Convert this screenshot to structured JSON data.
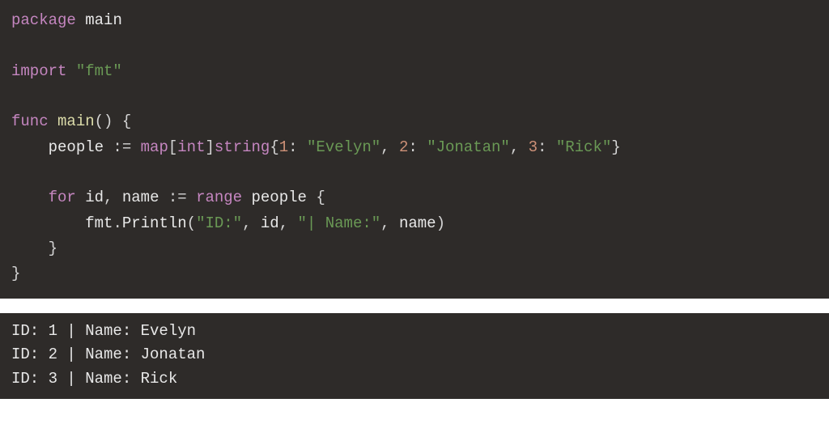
{
  "code": {
    "line1": {
      "kw_package": "package",
      "pkg_name": "main"
    },
    "line3": {
      "kw_import": "import",
      "import_path": "\"fmt\""
    },
    "line5": {
      "kw_func": "func",
      "fn_name": "main",
      "parens": "()",
      "brace_open": " {"
    },
    "line6": {
      "indent": "    ",
      "var_people": "people",
      "op_decl": " := ",
      "kw_map": "map",
      "bracket_open": "[",
      "type_int": "int",
      "bracket_close": "]",
      "type_string": "string",
      "brace_open": "{",
      "k1": "1",
      "colon1": ": ",
      "v1": "\"Evelyn\"",
      "comma1": ", ",
      "k2": "2",
      "colon2": ": ",
      "v2": "\"Jonatan\"",
      "comma2": ", ",
      "k3": "3",
      "colon3": ": ",
      "v3": "\"Rick\"",
      "brace_close": "}"
    },
    "line8": {
      "indent": "    ",
      "kw_for": "for",
      "var_id": " id",
      "comma": ", ",
      "var_name": "name",
      "op_decl": " := ",
      "kw_range": "range",
      "var_people": " people",
      "brace_open": " {"
    },
    "line9": {
      "indent": "        ",
      "pkg_fmt": "fmt",
      "dot": ".",
      "fn_println": "Println",
      "paren_open": "(",
      "arg1": "\"ID:\"",
      "c1": ", ",
      "arg2": "id",
      "c2": ", ",
      "arg3": "\"| Name:\"",
      "c3": ", ",
      "arg4": "name",
      "paren_close": ")"
    },
    "line10": {
      "indent": "    ",
      "brace_close": "}"
    },
    "line11": {
      "brace_close": "}"
    }
  },
  "output": {
    "line1": "ID: 1 | Name: Evelyn",
    "line2": "ID: 2 | Name: Jonatan",
    "line3": "ID: 3 | Name: Rick"
  }
}
